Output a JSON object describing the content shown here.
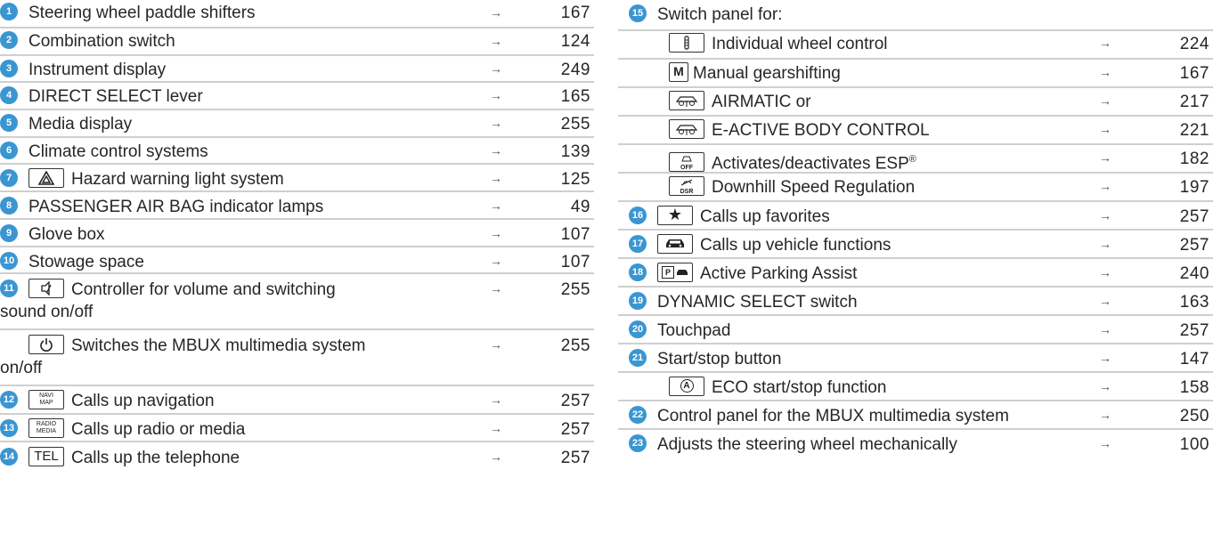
{
  "left_column": [
    {
      "number": "1",
      "label": "Steering wheel paddle shifters",
      "page": "167"
    },
    {
      "number": "2",
      "label": "Combination switch",
      "page": "124"
    },
    {
      "number": "3",
      "label": "Instrument display",
      "page": "249"
    },
    {
      "number": "4",
      "label": "DIRECT SELECT lever",
      "page": "165"
    },
    {
      "number": "5",
      "label": "Media display",
      "page": "255"
    },
    {
      "number": "6",
      "label": "Climate control systems",
      "page": "139"
    },
    {
      "number": "7",
      "label": "Hazard warning light system",
      "page": "125",
      "icon": "hazard-icon"
    },
    {
      "number": "8",
      "label": "PASSENGER AIR BAG indicator lamps",
      "page": "49"
    },
    {
      "number": "9",
      "label": "Glove box",
      "page": "107"
    },
    {
      "number": "10",
      "label": "Stowage space",
      "page": "107"
    },
    {
      "number": "11",
      "label_line1": "Controller for volume and switching",
      "label_line2": "sound on/off",
      "page": "255",
      "icon": "speaker-mute-icon"
    },
    {
      "number": "",
      "label_line1": "Switches the MBUX multimedia system",
      "label_line2": "on/off",
      "page": "255",
      "icon": "power-icon"
    },
    {
      "number": "12",
      "label": "Calls up navigation",
      "page": "257",
      "key_top": "NAVI",
      "key_bottom": "MAP"
    },
    {
      "number": "13",
      "label": "Calls up radio or media",
      "page": "257",
      "key_top": "RADIO",
      "key_bottom": "MEDIA"
    },
    {
      "number": "14",
      "label": "Calls up the telephone",
      "page": "257",
      "key": "TEL"
    }
  ],
  "right_column": [
    {
      "number": "15",
      "label": "Switch panel for:"
    },
    {
      "number": "",
      "label": "Individual wheel control",
      "page": "224",
      "icon": "wheel-control-icon"
    },
    {
      "number": "",
      "label": "Manual gearshifting",
      "page": "167",
      "key": "M"
    },
    {
      "number": "",
      "label": "AIRMATIC or",
      "page": "217",
      "icon": "suspension-icon"
    },
    {
      "number": "",
      "label": "E-ACTIVE BODY CONTROL",
      "page": "221",
      "icon": "suspension-icon"
    },
    {
      "number": "",
      "label": "Activates/deactivates ESP",
      "label_sup": "®",
      "page": "182",
      "icon": "esp-off-icon",
      "key_bottom": "OFF"
    },
    {
      "number": "",
      "label": "Downhill Speed Regulation",
      "page": "197",
      "icon": "dsr-icon",
      "key_bottom": "DSR"
    },
    {
      "number": "16",
      "label": "Calls up favorites",
      "page": "257",
      "icon": "star-icon"
    },
    {
      "number": "17",
      "label": "Calls up vehicle functions",
      "page": "257",
      "icon": "car-icon"
    },
    {
      "number": "18",
      "label": "Active Parking Assist",
      "page": "240",
      "icon": "parking-icon",
      "key_small": "P"
    },
    {
      "number": "19",
      "label": "DYNAMIC SELECT switch",
      "page": "163"
    },
    {
      "number": "20",
      "label": "Touchpad",
      "page": "257"
    },
    {
      "number": "21",
      "label": "Start/stop button",
      "page": "147"
    },
    {
      "number": "",
      "label": "ECO start/stop function",
      "page": "158",
      "icon": "eco-icon",
      "key": "A"
    },
    {
      "number": "22",
      "label": "Control panel for the MBUX multimedia system",
      "page": "250"
    },
    {
      "number": "23",
      "label": "Adjusts the steering wheel mechanically",
      "page": "100"
    }
  ],
  "arrow_symbol": "→",
  "colors": {
    "number_badge": "#3a96d2",
    "divider": "#cfcfcf",
    "text": "#262626"
  }
}
